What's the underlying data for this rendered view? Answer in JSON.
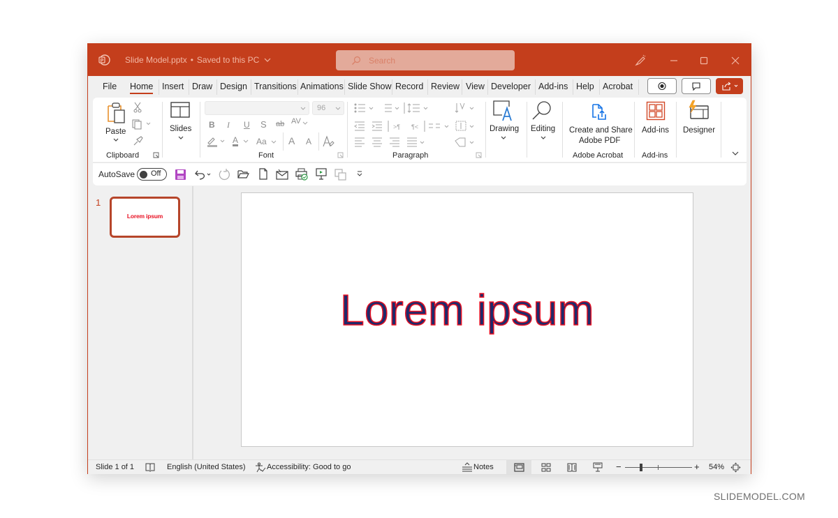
{
  "titlebar": {
    "filename": "Slide Model.pptx",
    "separator": "•",
    "save_status": "Saved to this PC",
    "search_placeholder": "Search"
  },
  "tabs": [
    {
      "label": "File",
      "active": false
    },
    {
      "label": "Home",
      "active": true
    },
    {
      "label": "Insert",
      "active": false
    },
    {
      "label": "Draw",
      "active": false
    },
    {
      "label": "Design",
      "active": false
    },
    {
      "label": "Transitions",
      "active": false
    },
    {
      "label": "Animations",
      "active": false
    },
    {
      "label": "Slide Show",
      "active": false
    },
    {
      "label": "Record",
      "active": false
    },
    {
      "label": "Review",
      "active": false
    },
    {
      "label": "View",
      "active": false
    },
    {
      "label": "Developer",
      "active": false
    },
    {
      "label": "Add-ins",
      "active": false
    },
    {
      "label": "Help",
      "active": false
    },
    {
      "label": "Acrobat",
      "active": false
    }
  ],
  "ribbon": {
    "clipboard": {
      "paste": "Paste",
      "group": "Clipboard"
    },
    "slides": {
      "label": "Slides"
    },
    "font": {
      "group": "Font",
      "font_name": "",
      "font_size": "96",
      "bold": "B",
      "italic": "I",
      "underline": "U",
      "shadow": "S",
      "strike": "ab",
      "spacing": "AV",
      "case": "Aa",
      "grow": "A",
      "shrink": "A"
    },
    "paragraph": {
      "group": "Paragraph"
    },
    "drawing": {
      "label": "Drawing"
    },
    "editing": {
      "label": "Editing"
    },
    "acrobat": {
      "line1": "Create and Share",
      "line2": "Adobe PDF",
      "group": "Adobe Acrobat"
    },
    "addins": {
      "label": "Add-ins",
      "group": "Add-ins"
    },
    "designer": {
      "label": "Designer"
    }
  },
  "qat": {
    "autosave_label": "AutoSave",
    "autosave_state": "Off"
  },
  "thumbnails": [
    {
      "number": "1",
      "text": "Lorem ipsum",
      "selected": true
    }
  ],
  "slide": {
    "title": "Lorem ipsum"
  },
  "statusbar": {
    "slide_count": "Slide 1 of 1",
    "language": "English (United States)",
    "accessibility": "Accessibility: Good to go",
    "notes": "Notes",
    "zoom_minus": "−",
    "zoom_plus": "+",
    "zoom_level": "54%",
    "zoom_fraction": 0.54
  },
  "watermark": "SLIDEMODEL.COM",
  "colors": {
    "accent": "#c43e1c",
    "slide_text_fill": "#1f2a6b",
    "slide_text_outline": "#e81123"
  }
}
